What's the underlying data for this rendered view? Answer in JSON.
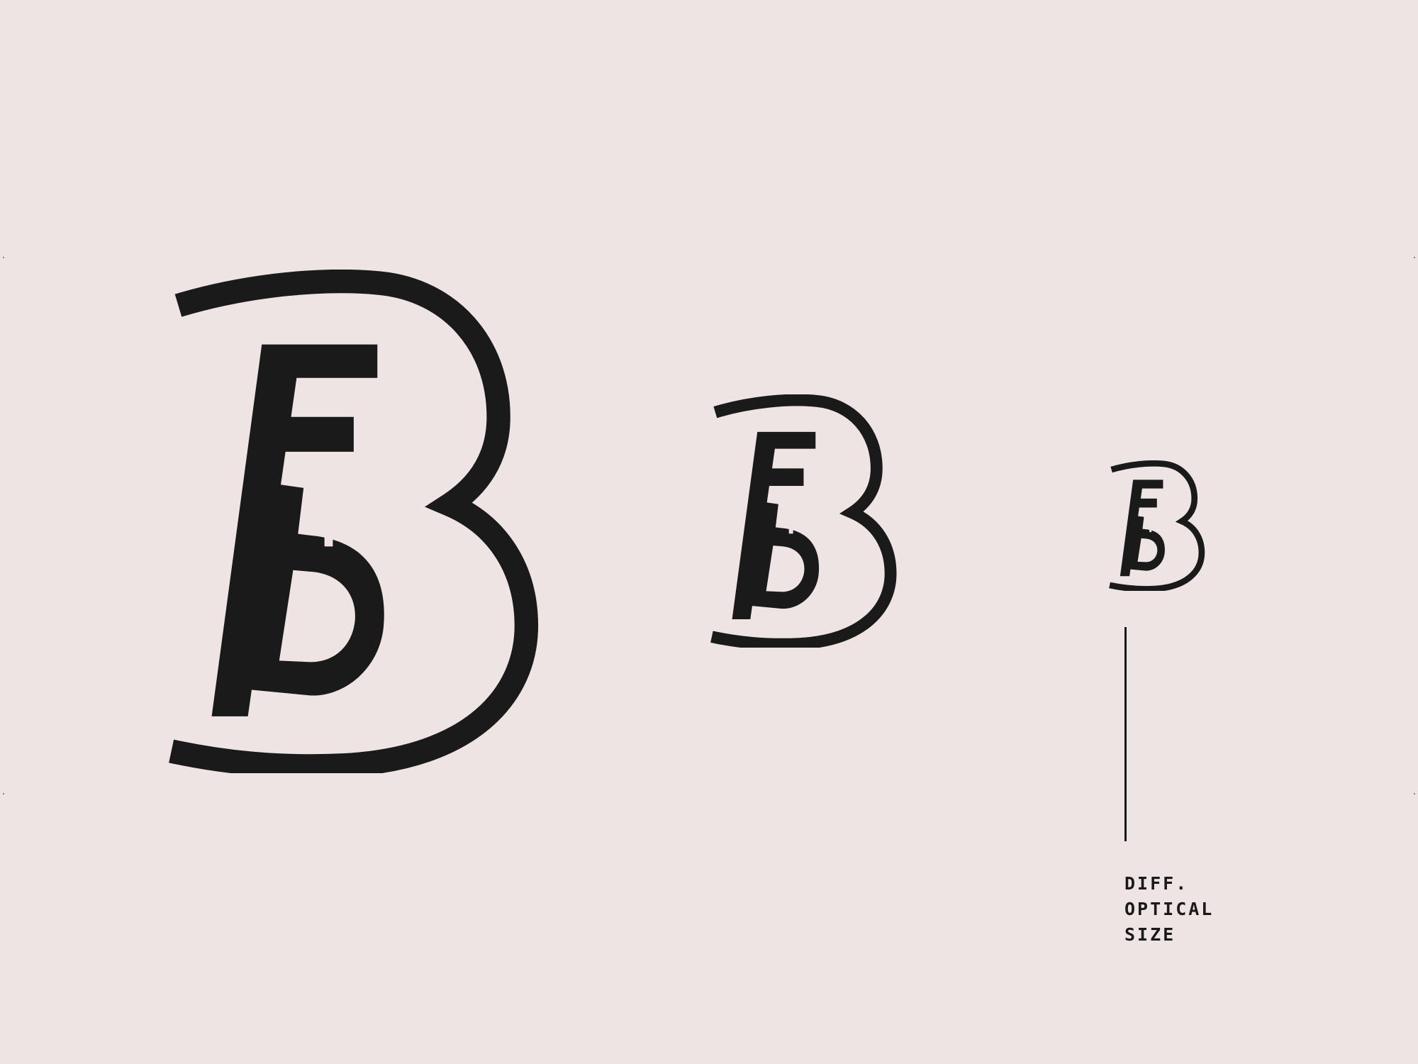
{
  "caption": {
    "line1": "DIFF.",
    "line2": "OPTICAL",
    "line3": "SIZE"
  },
  "colors": {
    "background": "#efe4e4",
    "ink": "#1a1a1a"
  }
}
